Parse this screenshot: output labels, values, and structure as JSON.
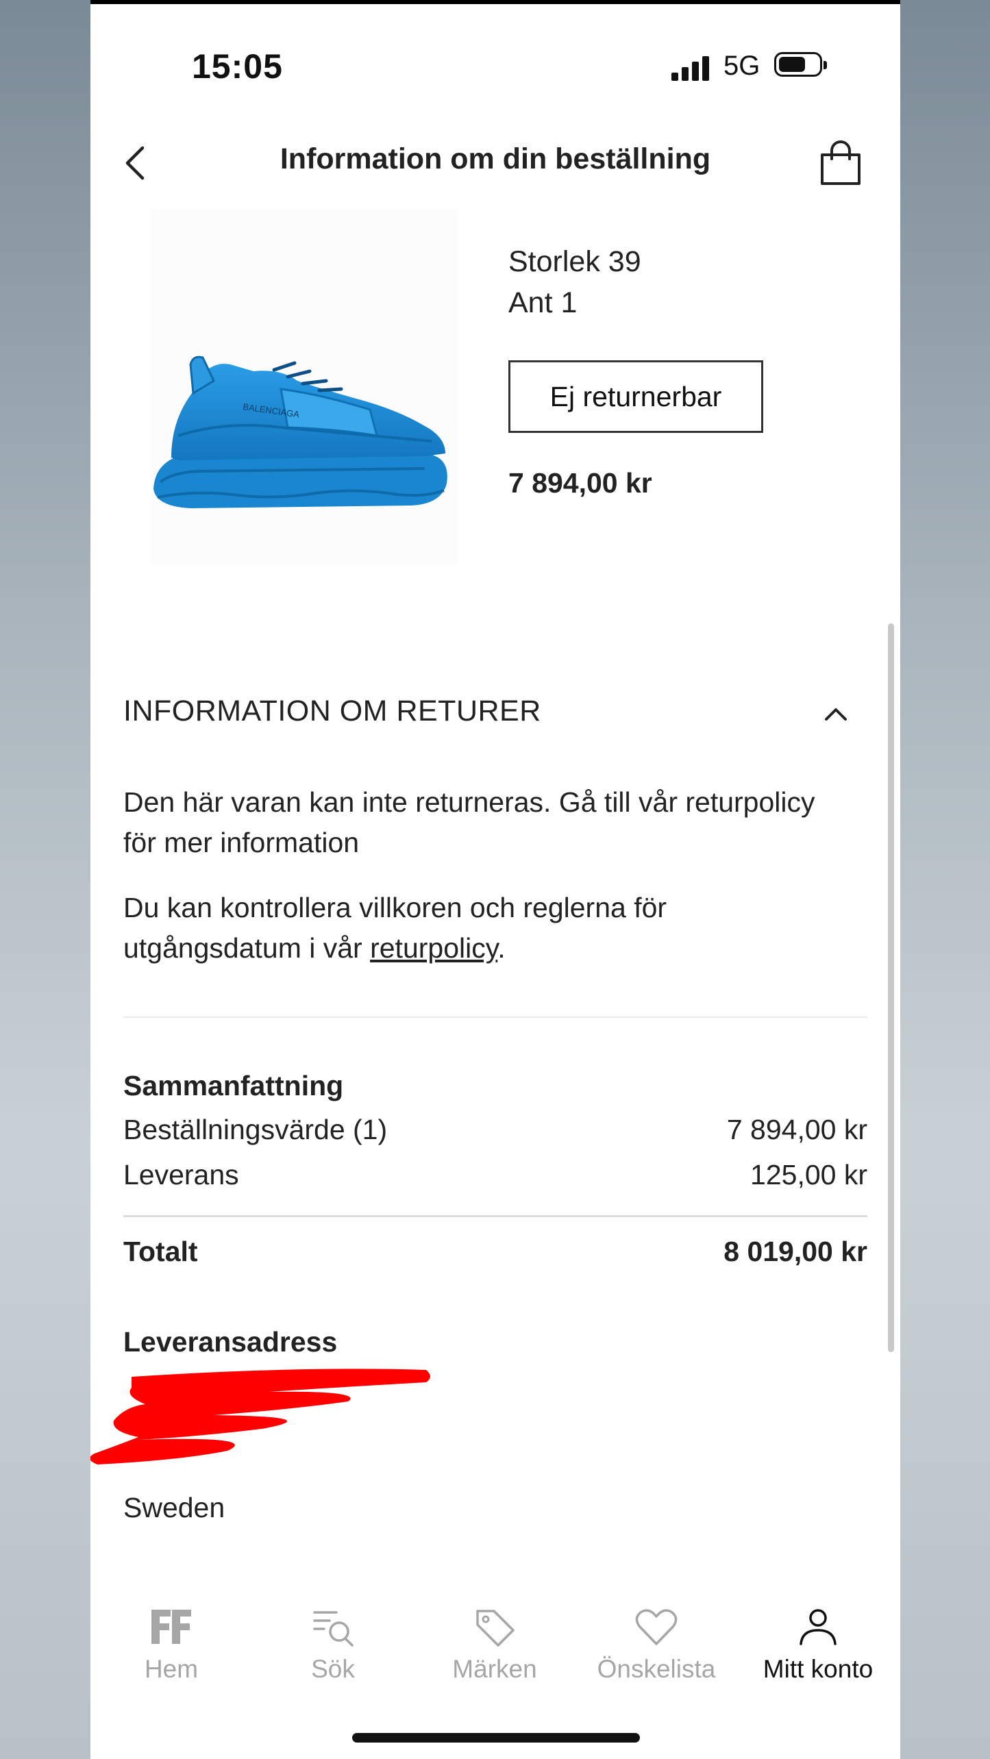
{
  "status_bar": {
    "time": "15:05",
    "network": "5G"
  },
  "header": {
    "title": "Information om din beställning"
  },
  "product": {
    "size": "Storlek 39",
    "quantity": "Ant 1",
    "return_status": "Ej returnerbar",
    "price": "7 894,00 kr",
    "brand_print": "BALENCIAGA",
    "shoe_color": "#1e8fd8"
  },
  "returns": {
    "title": "INFORMATION OM RETURER",
    "paragraph1": "Den här varan kan inte returneras. Gå till vår returpolicy för mer information",
    "paragraph2_prefix": "Du kan kontrollera villkoren och reglerna för utgångsdatum i vår ",
    "paragraph2_link": "returpolicy",
    "paragraph2_suffix": "."
  },
  "summary": {
    "title": "Sammanfattning",
    "rows": [
      {
        "label": "Beställningsvärde (1)",
        "value": "7 894,00 kr"
      },
      {
        "label": "Leverans",
        "value": "125,00 kr"
      }
    ],
    "total_label": "Totalt",
    "total_value": "8 019,00 kr"
  },
  "address": {
    "title": "Leveransadress",
    "country": "Sweden",
    "redaction_color": "#ff0000"
  },
  "tabbar": {
    "items": [
      {
        "label": "Hem",
        "icon": "farfetch-logo-icon",
        "active": false
      },
      {
        "label": "Sök",
        "icon": "search-icon",
        "active": false
      },
      {
        "label": "Märken",
        "icon": "tag-icon",
        "active": false
      },
      {
        "label": "Önskelista",
        "icon": "heart-icon",
        "active": false
      },
      {
        "label": "Mitt konto",
        "icon": "user-icon",
        "active": true
      }
    ]
  }
}
